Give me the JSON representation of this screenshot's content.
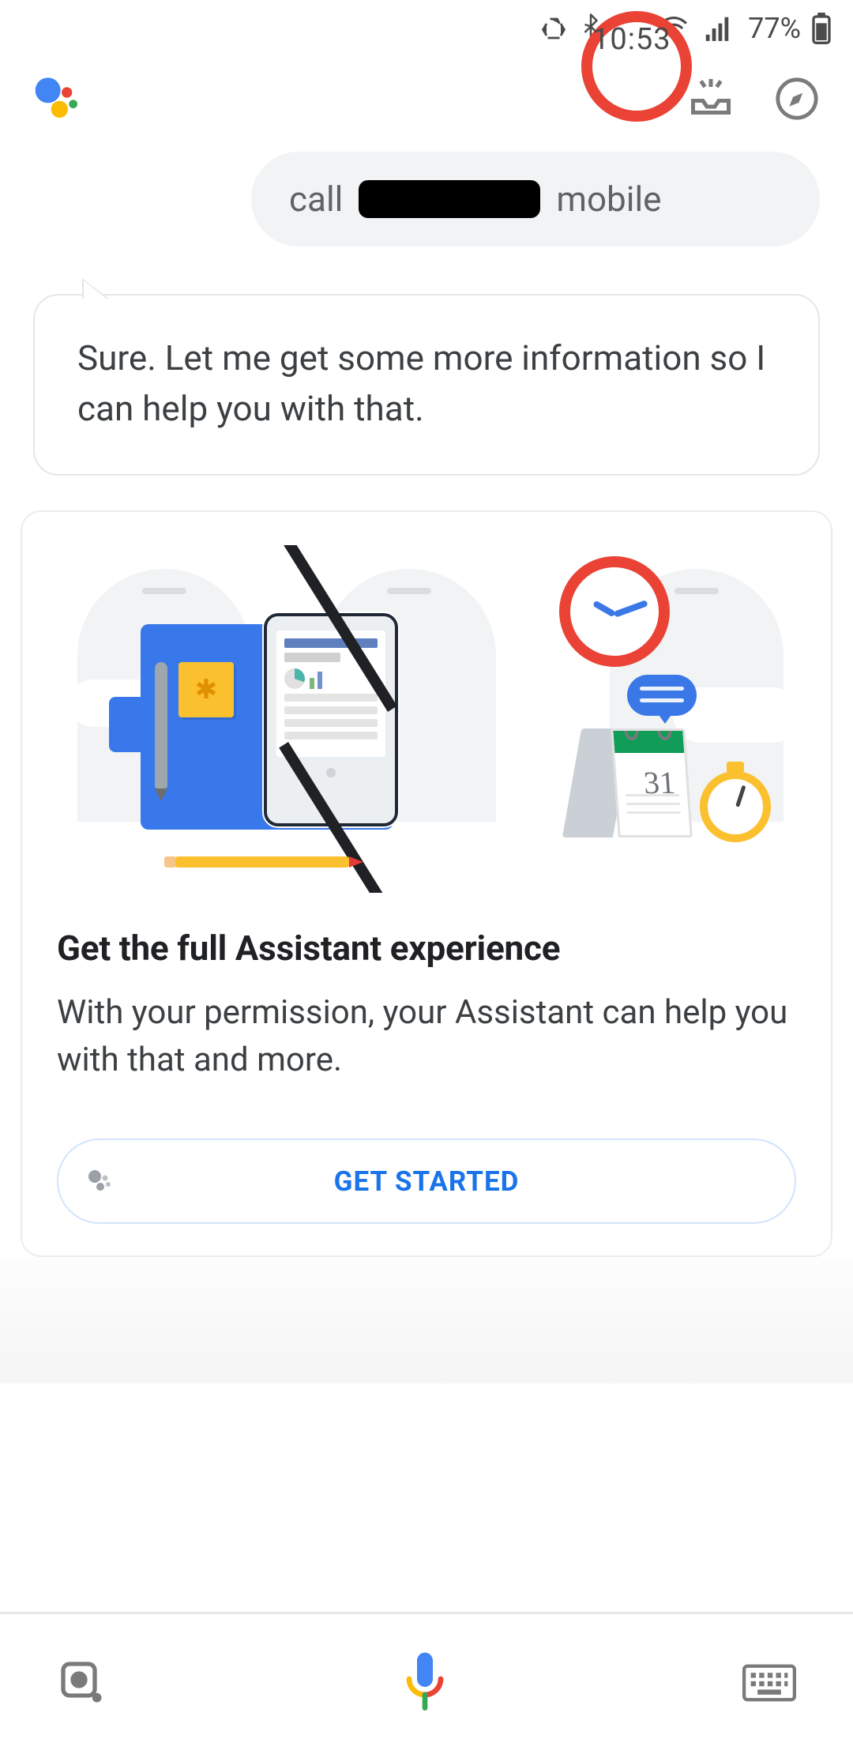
{
  "status_bar": {
    "battery_pct": "77%",
    "clock": "10:53"
  },
  "conversation": {
    "user_prefix": "call",
    "user_suffix": "mobile",
    "assistant_reply": "Sure. Let me get some more information so I can help you with that."
  },
  "promo_card": {
    "title": "Get the full Assistant experience",
    "body": "With your permission, your Assistant can help you with that and more.",
    "cta_label": "GET STARTED",
    "illustration": {
      "calendar_date": "31"
    }
  }
}
